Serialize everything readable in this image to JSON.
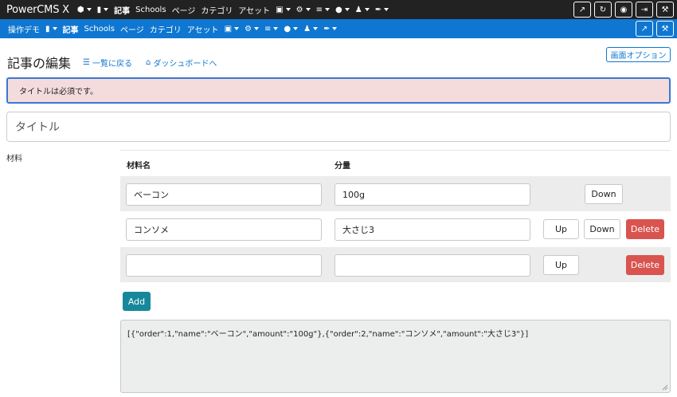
{
  "topbar": {
    "brand": "PowerCMS X",
    "items": [
      "記事",
      "Schools",
      "ページ",
      "カテゴリ",
      "アセット"
    ]
  },
  "bluebar": {
    "workspace": "操作デモ",
    "items": [
      "記事",
      "Schools",
      "ページ",
      "カテゴリ",
      "アセット"
    ]
  },
  "header": {
    "title": "記事の編集",
    "back_link": "一覧に戻る",
    "dashboard_link": "ダッシュボードへ",
    "options_button": "画面オプション"
  },
  "alert": {
    "message": "タイトルは必須です。"
  },
  "title_field": {
    "placeholder": "タイトル",
    "value": ""
  },
  "ingredients": {
    "label": "材料",
    "col_name": "材料名",
    "col_amount": "分量",
    "rows": [
      {
        "name": "ベーコン",
        "amount": "100g",
        "up": "",
        "down": "Down",
        "delete": ""
      },
      {
        "name": "コンソメ",
        "amount": "大さじ3",
        "up": "Up",
        "down": "Down",
        "delete": "Delete"
      },
      {
        "name": "",
        "amount": "",
        "up": "Up",
        "down": "",
        "delete": "Delete"
      }
    ],
    "add_button": "Add",
    "json_value": "[{\"order\":1,\"name\":\"ベーコン\",\"amount\":\"100g\"},{\"order\":2,\"name\":\"コンソメ\",\"amount\":\"大さじ3\"}]"
  },
  "colors": {
    "topbar_bg": "#222222",
    "bluebar_bg": "#0f77d1",
    "alert_bg": "#f4dcdc",
    "delete_red": "#d9534f",
    "add_teal": "#17889b"
  }
}
